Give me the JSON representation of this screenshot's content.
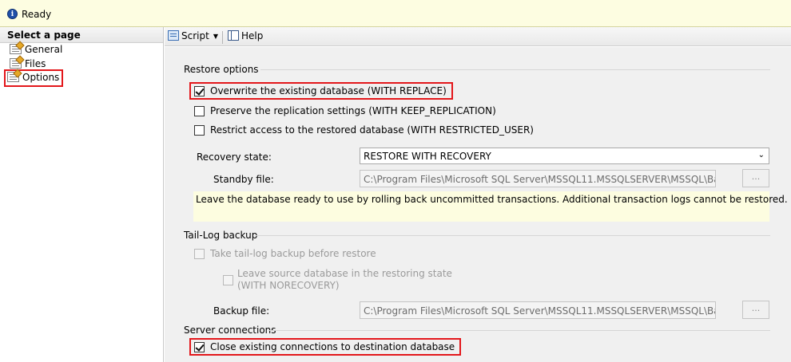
{
  "status": {
    "text": "Ready",
    "icon": "info-icon"
  },
  "left_pane": {
    "header": "Select a page",
    "items": [
      {
        "label": "General",
        "icon": "page-icon"
      },
      {
        "label": "Files",
        "icon": "page-icon"
      },
      {
        "label": "Options",
        "icon": "page-icon",
        "selected": true
      }
    ]
  },
  "toolbar": {
    "script_label": "Script",
    "help_label": "Help"
  },
  "restore_options": {
    "title": "Restore options",
    "overwrite": {
      "label": "Overwrite the existing database (WITH REPLACE)",
      "checked": true
    },
    "preserve_replication": {
      "label": "Preserve the replication settings (WITH KEEP_REPLICATION)",
      "checked": false
    },
    "restrict_access": {
      "label": "Restrict access to the restored database (WITH RESTRICTED_USER)",
      "checked": false
    },
    "recovery_state_label": "Recovery state:",
    "recovery_state_value": "RESTORE WITH RECOVERY",
    "standby_label": "Standby file:",
    "standby_value": "C:\\Program Files\\Microsoft SQL Server\\MSSQL11.MSSQLSERVER\\MSSQL\\Backup\\te",
    "browse_label": "...",
    "info": "Leave the database ready to use by rolling back uncommitted transactions. Additional transaction logs cannot be restored."
  },
  "tail_log": {
    "title": "Tail-Log backup",
    "take_backup": {
      "label": "Take tail-log backup before restore",
      "checked": false
    },
    "leave_source_line1": "Leave source database in the restoring state",
    "leave_source_line2": "(WITH NORECOVERY)",
    "backup_file_label": "Backup file:",
    "backup_file_value": "C:\\Program Files\\Microsoft SQL Server\\MSSQL11.MSSQLSERVER\\MSSQL\\Backup\\te",
    "browse_label": "..."
  },
  "server_connections": {
    "title": "Server connections",
    "close_connections": {
      "label": "Close existing connections to destination database",
      "checked": true
    }
  },
  "colors": {
    "highlight": "#e3171b",
    "status_bar": "#fdfde1",
    "info_box": "#fdfde0",
    "panel_bg": "#f0f0f0"
  }
}
